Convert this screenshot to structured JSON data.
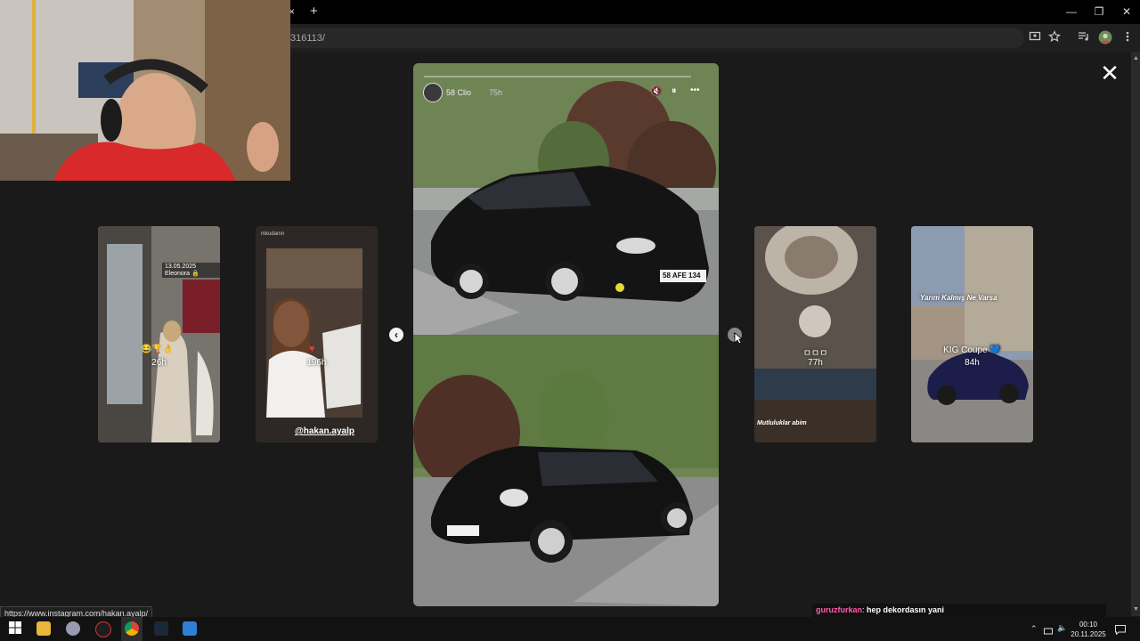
{
  "browser": {
    "url_fragment": "316113/",
    "new_tab_label": "+",
    "tab_close": "×",
    "window_controls": {
      "minimize": "—",
      "restore": "❐",
      "close": "✕"
    },
    "toolbar_icons": [
      "install-icon",
      "bookmark-star-icon",
      "media-controls-icon",
      "profile-avatar-icon",
      "menu-icon"
    ]
  },
  "viewer": {
    "close_label": "✕",
    "main_story": {
      "username": "58 Clio",
      "time": "75h",
      "controls": {
        "mute": "🔇",
        "pause": "⏸",
        "more": "•••"
      }
    },
    "prev_arrow": "‹",
    "next_arrow": "›",
    "side_stories": [
      {
        "time": "26h",
        "caption": "13.05.2025 Eleonora 🔒"
      },
      {
        "time": "196h",
        "handle": "@hakan.ayalp",
        "user_tag": "mkudanın"
      },
      {
        "name": "ㅁㅁㅁ",
        "time": "77h",
        "caption": "Mutluluklar abim"
      },
      {
        "name": "KIG Coupe 💙",
        "time": "84h",
        "caption": "Yarım Kalmış Ne Varsa"
      }
    ],
    "plate_text": "58 AFE 134"
  },
  "status_url": "https://www.instagram.com/hakan.ayalp/",
  "chat": {
    "user": "guruzfurkan",
    "separator": ": ",
    "message": "hep dekordasın yani",
    "user_color": "#ff5cad"
  },
  "taskbar": {
    "time": "00:10",
    "date": "20.11.2025",
    "apps": [
      "windows-start-icon",
      "file-explorer-icon",
      "steam-icon",
      "obs-icon",
      "chrome-icon",
      "steam-client-icon",
      "app-icon"
    ]
  }
}
